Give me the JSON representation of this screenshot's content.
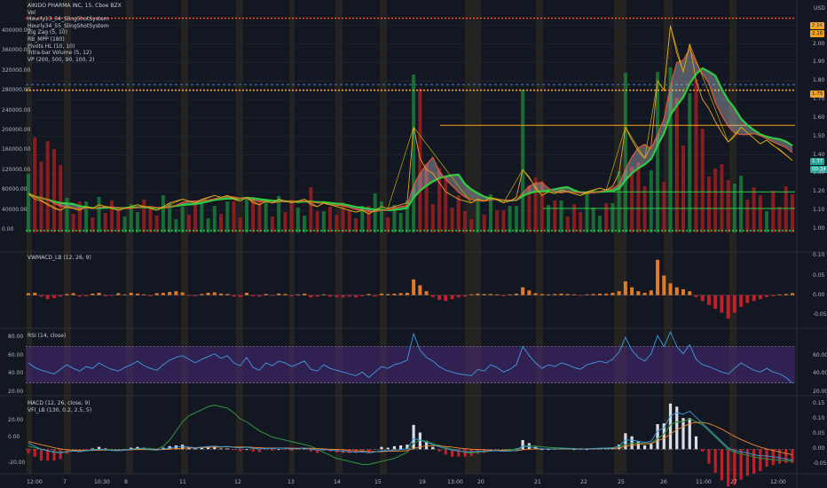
{
  "chart_data": {
    "type": "line",
    "title": "AIKIDO PHARMA INC, 15, Cboe BZX",
    "currency": "USD",
    "legend": [
      "Vol",
      "Hourly13_34_SlingShotSystem",
      "Hourly34_55_SlingShotSystem",
      "Zig Zag (5, 10)",
      "RB_MPP (180)",
      "Pivots HL (10, 10)",
      "intra-bar Volume (5, 12)",
      "VP (200, 500, 90, 100, 2)"
    ],
    "x_ticks": [
      "12:00",
      "7",
      "10:30",
      "8",
      "11",
      "12",
      "13",
      "14",
      "15",
      "19",
      "13:00",
      "20",
      "21",
      "22",
      "25",
      "26",
      "11:00",
      "27",
      "12:00"
    ],
    "price": {
      "right_ticks": [
        "2.10",
        "2.00",
        "1.90",
        "1.80",
        "1.70",
        "1.60",
        "1.50",
        "1.40",
        "1.30",
        "1.20",
        "1.10",
        "1.00"
      ],
      "left_ticks": [
        "400000.00",
        "360000.00",
        "320000.00",
        "280000.00",
        "240000.00",
        "200000.00",
        "160000.00",
        "120000.00",
        "80000.00",
        "40000.00",
        "0.00"
      ],
      "ylim": [
        0.98,
        2.2
      ],
      "last_price": "1.37",
      "countdown": "00:34",
      "markers": [
        "2.14",
        "2.16",
        "1.75"
      ],
      "levels": [
        2.14,
        1.78,
        1.75,
        1.56,
        1.2,
        1.11
      ],
      "series": [
        {
          "name": "Close",
          "values": [
            1.19,
            1.16,
            1.15,
            1.13,
            1.11,
            1.1,
            1.12,
            1.11,
            1.1,
            1.12,
            1.11,
            1.13,
            1.12,
            1.11,
            1.1,
            1.11,
            1.12,
            1.13,
            1.12,
            1.11,
            1.1,
            1.12,
            1.14,
            1.15,
            1.16,
            1.15,
            1.14,
            1.16,
            1.17,
            1.18,
            1.17,
            1.18,
            1.16,
            1.15,
            1.17,
            1.14,
            1.13,
            1.15,
            1.14,
            1.16,
            1.15,
            1.14,
            1.15,
            1.16,
            1.13,
            1.12,
            1.14,
            1.13,
            1.12,
            1.11,
            1.1,
            1.09,
            1.1,
            1.08,
            1.1,
            1.12,
            1.11,
            1.12,
            1.13,
            1.14,
            1.55,
            1.38,
            1.32,
            1.3,
            1.25,
            1.2,
            1.18,
            1.16,
            1.15,
            1.14,
            1.16,
            1.15,
            1.17,
            1.16,
            1.14,
            1.15,
            1.17,
            1.32,
            1.28,
            1.22,
            1.18,
            1.2,
            1.19,
            1.21,
            1.2,
            1.19,
            1.18,
            1.2,
            1.21,
            1.22,
            1.21,
            1.23,
            1.3,
            1.55,
            1.48,
            1.42,
            1.38,
            1.45,
            1.8,
            1.75,
            2.1,
            1.95,
            1.85,
            2.0,
            1.8,
            1.7,
            1.65,
            1.58,
            1.52,
            1.47,
            1.5,
            1.55,
            1.52,
            1.49,
            1.46,
            1.48,
            1.45,
            1.43,
            1.4,
            1.37
          ]
        }
      ]
    },
    "vwmacd": {
      "title": "VWMACD_LB (12, 26, 9)",
      "right_ticks": [
        "0.10",
        "0.05",
        "0.00",
        "-0.05"
      ],
      "ylim": [
        -0.08,
        0.11
      ],
      "histogram": [
        0.005,
        0.006,
        -0.004,
        -0.01,
        -0.008,
        -0.004,
        0.003,
        0.005,
        -0.004,
        -0.003,
        0.004,
        0.006,
        -0.003,
        -0.002,
        0.005,
        0.002,
        0.006,
        0.004,
        0.002,
        -0.003,
        0.005,
        0.006,
        0.008,
        0.01,
        0.007,
        -0.002,
        -0.003,
        0.003,
        0.006,
        0.007,
        0.004,
        0.003,
        -0.004,
        -0.005,
        0.006,
        -0.003,
        -0.004,
        0.003,
        -0.002,
        0.004,
        0.003,
        -0.003,
        0.002,
        0.004,
        -0.006,
        -0.004,
        0.002,
        -0.004,
        -0.005,
        -0.006,
        -0.004,
        -0.006,
        -0.003,
        0.003,
        -0.004,
        0.004,
        0.003,
        0.004,
        0.005,
        0.006,
        0.04,
        0.025,
        0.01,
        -0.005,
        -0.012,
        -0.015,
        -0.01,
        -0.006,
        -0.004,
        0.002,
        0.004,
        0.003,
        0.003,
        0.002,
        -0.003,
        0.002,
        0.004,
        0.02,
        0.012,
        0.005,
        0.003,
        0.002,
        0.003,
        0.004,
        0.003,
        0.002,
        -0.002,
        0.002,
        0.003,
        0.004,
        0.004,
        0.006,
        0.01,
        0.035,
        0.02,
        0.01,
        0.006,
        0.012,
        0.09,
        0.05,
        0.03,
        0.02,
        0.015,
        0.01,
        -0.005,
        -0.015,
        -0.025,
        -0.035,
        -0.045,
        -0.06,
        -0.045,
        -0.03,
        -0.02,
        -0.015,
        -0.01,
        -0.005,
        -0.003,
        0.002,
        0.003,
        0.005
      ]
    },
    "rsi": {
      "title": "RSI (14, close)",
      "right_ticks": [
        "60.00",
        "40.00",
        "20.00"
      ],
      "left_ticks": [
        "80.00",
        "60.00",
        "40.00",
        "20.00"
      ],
      "band": [
        30,
        70
      ],
      "ylim": [
        18,
        88
      ],
      "values": [
        52,
        47,
        44,
        42,
        40,
        45,
        50,
        46,
        43,
        48,
        46,
        52,
        48,
        45,
        43,
        47,
        50,
        54,
        49,
        46,
        44,
        50,
        55,
        58,
        60,
        56,
        52,
        56,
        59,
        62,
        57,
        60,
        52,
        49,
        58,
        47,
        44,
        52,
        49,
        54,
        52,
        48,
        51,
        54,
        45,
        43,
        50,
        46,
        44,
        42,
        40,
        38,
        42,
        36,
        42,
        48,
        46,
        50,
        52,
        55,
        84,
        66,
        58,
        54,
        48,
        44,
        42,
        40,
        39,
        38,
        45,
        43,
        50,
        47,
        42,
        45,
        50,
        70,
        60,
        52,
        46,
        50,
        48,
        52,
        50,
        47,
        45,
        50,
        52,
        54,
        52,
        56,
        64,
        80,
        66,
        58,
        54,
        62,
        82,
        70,
        86,
        70,
        62,
        72,
        56,
        50,
        48,
        45,
        42,
        40,
        46,
        52,
        48,
        44,
        42,
        46,
        42,
        40,
        36,
        30
      ]
    },
    "macd": {
      "title": "MACD (12, 26, close, 9)",
      "vfi_title": "VFI_LB (130, 0.2, 2.5, 5)",
      "right_ticks": [
        "0.15",
        "0.10",
        "0.05",
        "0.00",
        "-0.05"
      ],
      "left_ticks": [
        "20.00",
        "0.00",
        "-20.00"
      ],
      "ylim": [
        -0.075,
        0.17
      ],
      "macd": [
        0.02,
        0.01,
        0.0,
        -0.005,
        -0.01,
        -0.012,
        -0.008,
        -0.006,
        -0.008,
        -0.005,
        -0.003,
        0.0,
        -0.002,
        -0.004,
        -0.005,
        -0.003,
        0.0,
        0.002,
        0.001,
        -0.002,
        -0.003,
        0.001,
        0.004,
        0.007,
        0.009,
        0.007,
        0.005,
        0.007,
        0.009,
        0.01,
        0.008,
        0.009,
        0.006,
        0.004,
        0.007,
        0.003,
        0.001,
        0.003,
        0.002,
        0.004,
        0.003,
        0.001,
        0.002,
        0.004,
        0.0,
        -0.003,
        -0.001,
        -0.003,
        -0.005,
        -0.007,
        -0.009,
        -0.01,
        -0.009,
        -0.012,
        -0.009,
        -0.005,
        -0.005,
        -0.003,
        -0.001,
        0.001,
        0.035,
        0.03,
        0.022,
        0.015,
        0.008,
        0.002,
        -0.003,
        -0.006,
        -0.008,
        -0.009,
        -0.007,
        -0.007,
        -0.005,
        -0.005,
        -0.007,
        -0.006,
        -0.004,
        0.01,
        0.008,
        0.004,
        0.001,
        0.001,
        0.0,
        0.002,
        0.002,
        0.001,
        0.0,
        0.001,
        0.002,
        0.003,
        0.003,
        0.004,
        0.01,
        0.03,
        0.03,
        0.026,
        0.022,
        0.026,
        0.06,
        0.07,
        0.11,
        0.12,
        0.115,
        0.125,
        0.105,
        0.085,
        0.065,
        0.045,
        0.025,
        0.005,
        -0.005,
        -0.008,
        -0.012,
        -0.018,
        -0.022,
        -0.022,
        -0.025,
        -0.028,
        -0.032,
        -0.036
      ],
      "signal": [
        0.025,
        0.02,
        0.015,
        0.01,
        0.005,
        0.001,
        -0.002,
        -0.003,
        -0.004,
        -0.004,
        -0.004,
        -0.003,
        -0.003,
        -0.003,
        -0.003,
        -0.003,
        -0.002,
        -0.001,
        -0.001,
        -0.001,
        -0.001,
        -0.001,
        0.0,
        0.002,
        0.003,
        0.004,
        0.004,
        0.005,
        0.006,
        0.007,
        0.007,
        0.008,
        0.007,
        0.007,
        0.007,
        0.006,
        0.005,
        0.004,
        0.004,
        0.004,
        0.004,
        0.003,
        0.003,
        0.003,
        0.003,
        0.002,
        0.001,
        0.0,
        -0.001,
        -0.002,
        -0.004,
        -0.005,
        -0.006,
        -0.007,
        -0.008,
        -0.008,
        -0.007,
        -0.007,
        -0.006,
        -0.005,
        0.003,
        0.008,
        0.011,
        0.012,
        0.011,
        0.009,
        0.007,
        0.004,
        0.002,
        0.0,
        -0.001,
        -0.002,
        -0.003,
        -0.004,
        -0.004,
        -0.005,
        -0.005,
        -0.002,
        0.0,
        0.001,
        0.001,
        0.001,
        0.001,
        0.001,
        0.001,
        0.001,
        0.001,
        0.001,
        0.001,
        0.002,
        0.002,
        0.002,
        0.004,
        0.009,
        0.013,
        0.016,
        0.017,
        0.019,
        0.027,
        0.036,
        0.05,
        0.064,
        0.074,
        0.084,
        0.088,
        0.088,
        0.084,
        0.076,
        0.066,
        0.054,
        0.042,
        0.032,
        0.023,
        0.014,
        0.007,
        0.001,
        -0.004,
        -0.009,
        -0.014,
        -0.018
      ],
      "vfi": [
        0.01,
        0.005,
        0.0,
        -0.005,
        -0.008,
        -0.01,
        -0.008,
        -0.006,
        -0.006,
        -0.004,
        -0.002,
        0.0,
        -0.001,
        -0.002,
        -0.003,
        -0.002,
        0.0,
        0.002,
        0.003,
        0.002,
        0.0,
        0.01,
        0.03,
        0.06,
        0.09,
        0.11,
        0.12,
        0.13,
        0.14,
        0.145,
        0.14,
        0.135,
        0.12,
        0.1,
        0.09,
        0.075,
        0.06,
        0.05,
        0.04,
        0.035,
        0.03,
        0.025,
        0.02,
        0.015,
        0.01,
        0.0,
        -0.01,
        -0.02,
        -0.03,
        -0.035,
        -0.04,
        -0.045,
        -0.05,
        -0.05,
        -0.045,
        -0.04,
        -0.035,
        -0.03,
        -0.02,
        -0.01,
        0.02,
        0.03,
        0.025,
        0.018,
        0.012,
        0.006,
        0.0,
        -0.005,
        -0.01,
        -0.012,
        -0.01,
        -0.008,
        -0.006,
        -0.004,
        -0.003,
        -0.002,
        0.0,
        0.01,
        0.012,
        0.01,
        0.008,
        0.006,
        0.005,
        0.004,
        0.003,
        0.002,
        0.001,
        0.001,
        0.002,
        0.003,
        0.004,
        0.005,
        0.008,
        0.015,
        0.02,
        0.02,
        0.018,
        0.02,
        0.035,
        0.05,
        0.08,
        0.09,
        0.09,
        0.1,
        0.09,
        0.08,
        0.06,
        0.04,
        0.02,
        0.0,
        -0.01,
        -0.015,
        -0.02,
        -0.025,
        -0.03,
        -0.032,
        -0.034,
        -0.036,
        -0.038,
        -0.04
      ]
    }
  }
}
